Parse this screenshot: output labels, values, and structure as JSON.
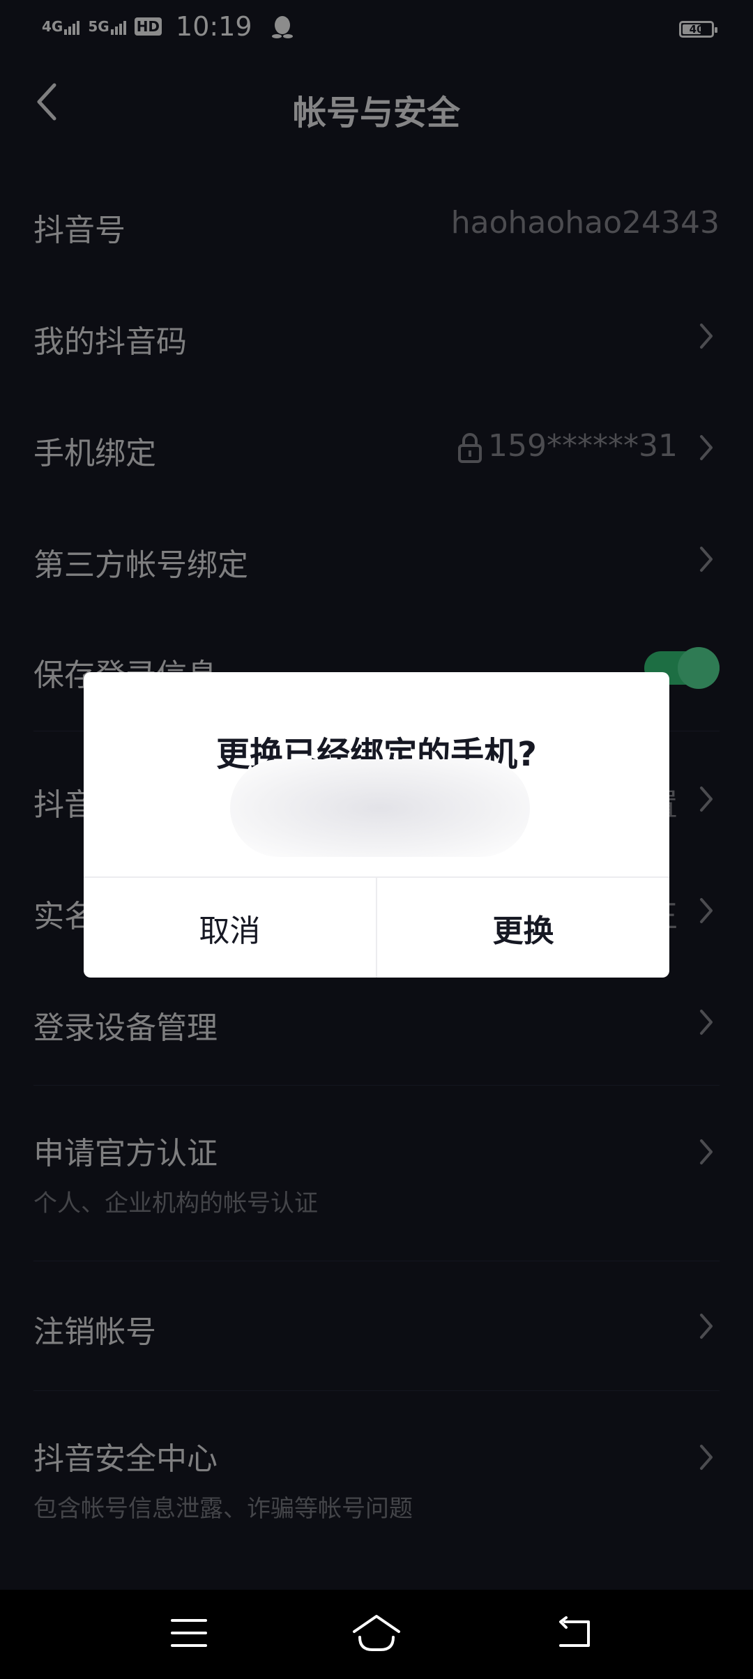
{
  "status_bar": {
    "network1": "4G",
    "network2": "5G",
    "hd": "HD",
    "time": "10:19",
    "battery": "40"
  },
  "header": {
    "title": "帐号与安全"
  },
  "settings": {
    "douyin_id_label": "抖音号",
    "douyin_id_value": "haohaohao24343",
    "qr_code_label": "我的抖音码",
    "phone_label": "手机绑定",
    "phone_value": "159******31",
    "third_party_label": "第三方帐号绑定",
    "save_login_label": "保存登录信息",
    "partial_row6_label": "抖音",
    "partial_row6_value": "置",
    "partial_row7_label": "实名",
    "partial_row7_value": "正",
    "device_mgmt_label": "登录设备管理",
    "official_cert_label": "申请官方认证",
    "official_cert_sub": "个人、企业机构的帐号认证",
    "cancel_account_label": "注销帐号",
    "security_center_label": "抖音安全中心",
    "security_center_sub": "包含帐号信息泄露、诈骗等帐号问题"
  },
  "dialog": {
    "title": "更换已经绑定的手机?",
    "cancel_label": "取消",
    "confirm_label": "更换"
  },
  "colors": {
    "background": "#161823",
    "toggle_on": "#36c97a",
    "dialog_bg": "#ffffff"
  }
}
